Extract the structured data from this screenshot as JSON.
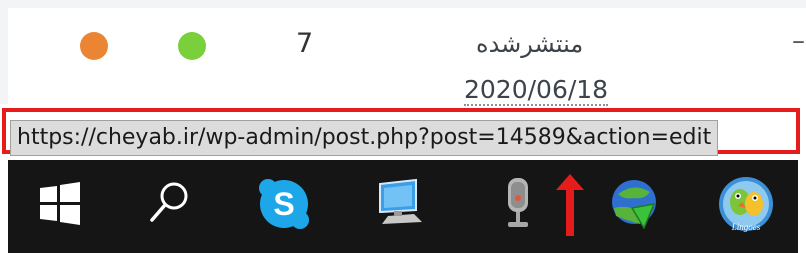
{
  "row": {
    "count": "7",
    "status": "منتشرشده",
    "date": "2020/06/18",
    "dash": "–",
    "dot_colors": {
      "orange": "#ec8533",
      "green": "#7ad03a"
    }
  },
  "status_bar": {
    "url": "https://cheyab.ir/wp-admin/post.php?post=14589&action=edit",
    "highlight_color": "#e41c1c"
  },
  "taskbar": {
    "items": [
      {
        "icon": "windows-start-icon"
      },
      {
        "icon": "search-icon"
      },
      {
        "icon": "skype-icon",
        "letter": "S"
      },
      {
        "icon": "this-pc-icon"
      },
      {
        "icon": "microphone-icon"
      },
      {
        "icon": "red-up-arrow-icon"
      },
      {
        "icon": "idm-download-icon"
      },
      {
        "icon": "lingoes-icon",
        "label": "Lingoes"
      }
    ]
  }
}
